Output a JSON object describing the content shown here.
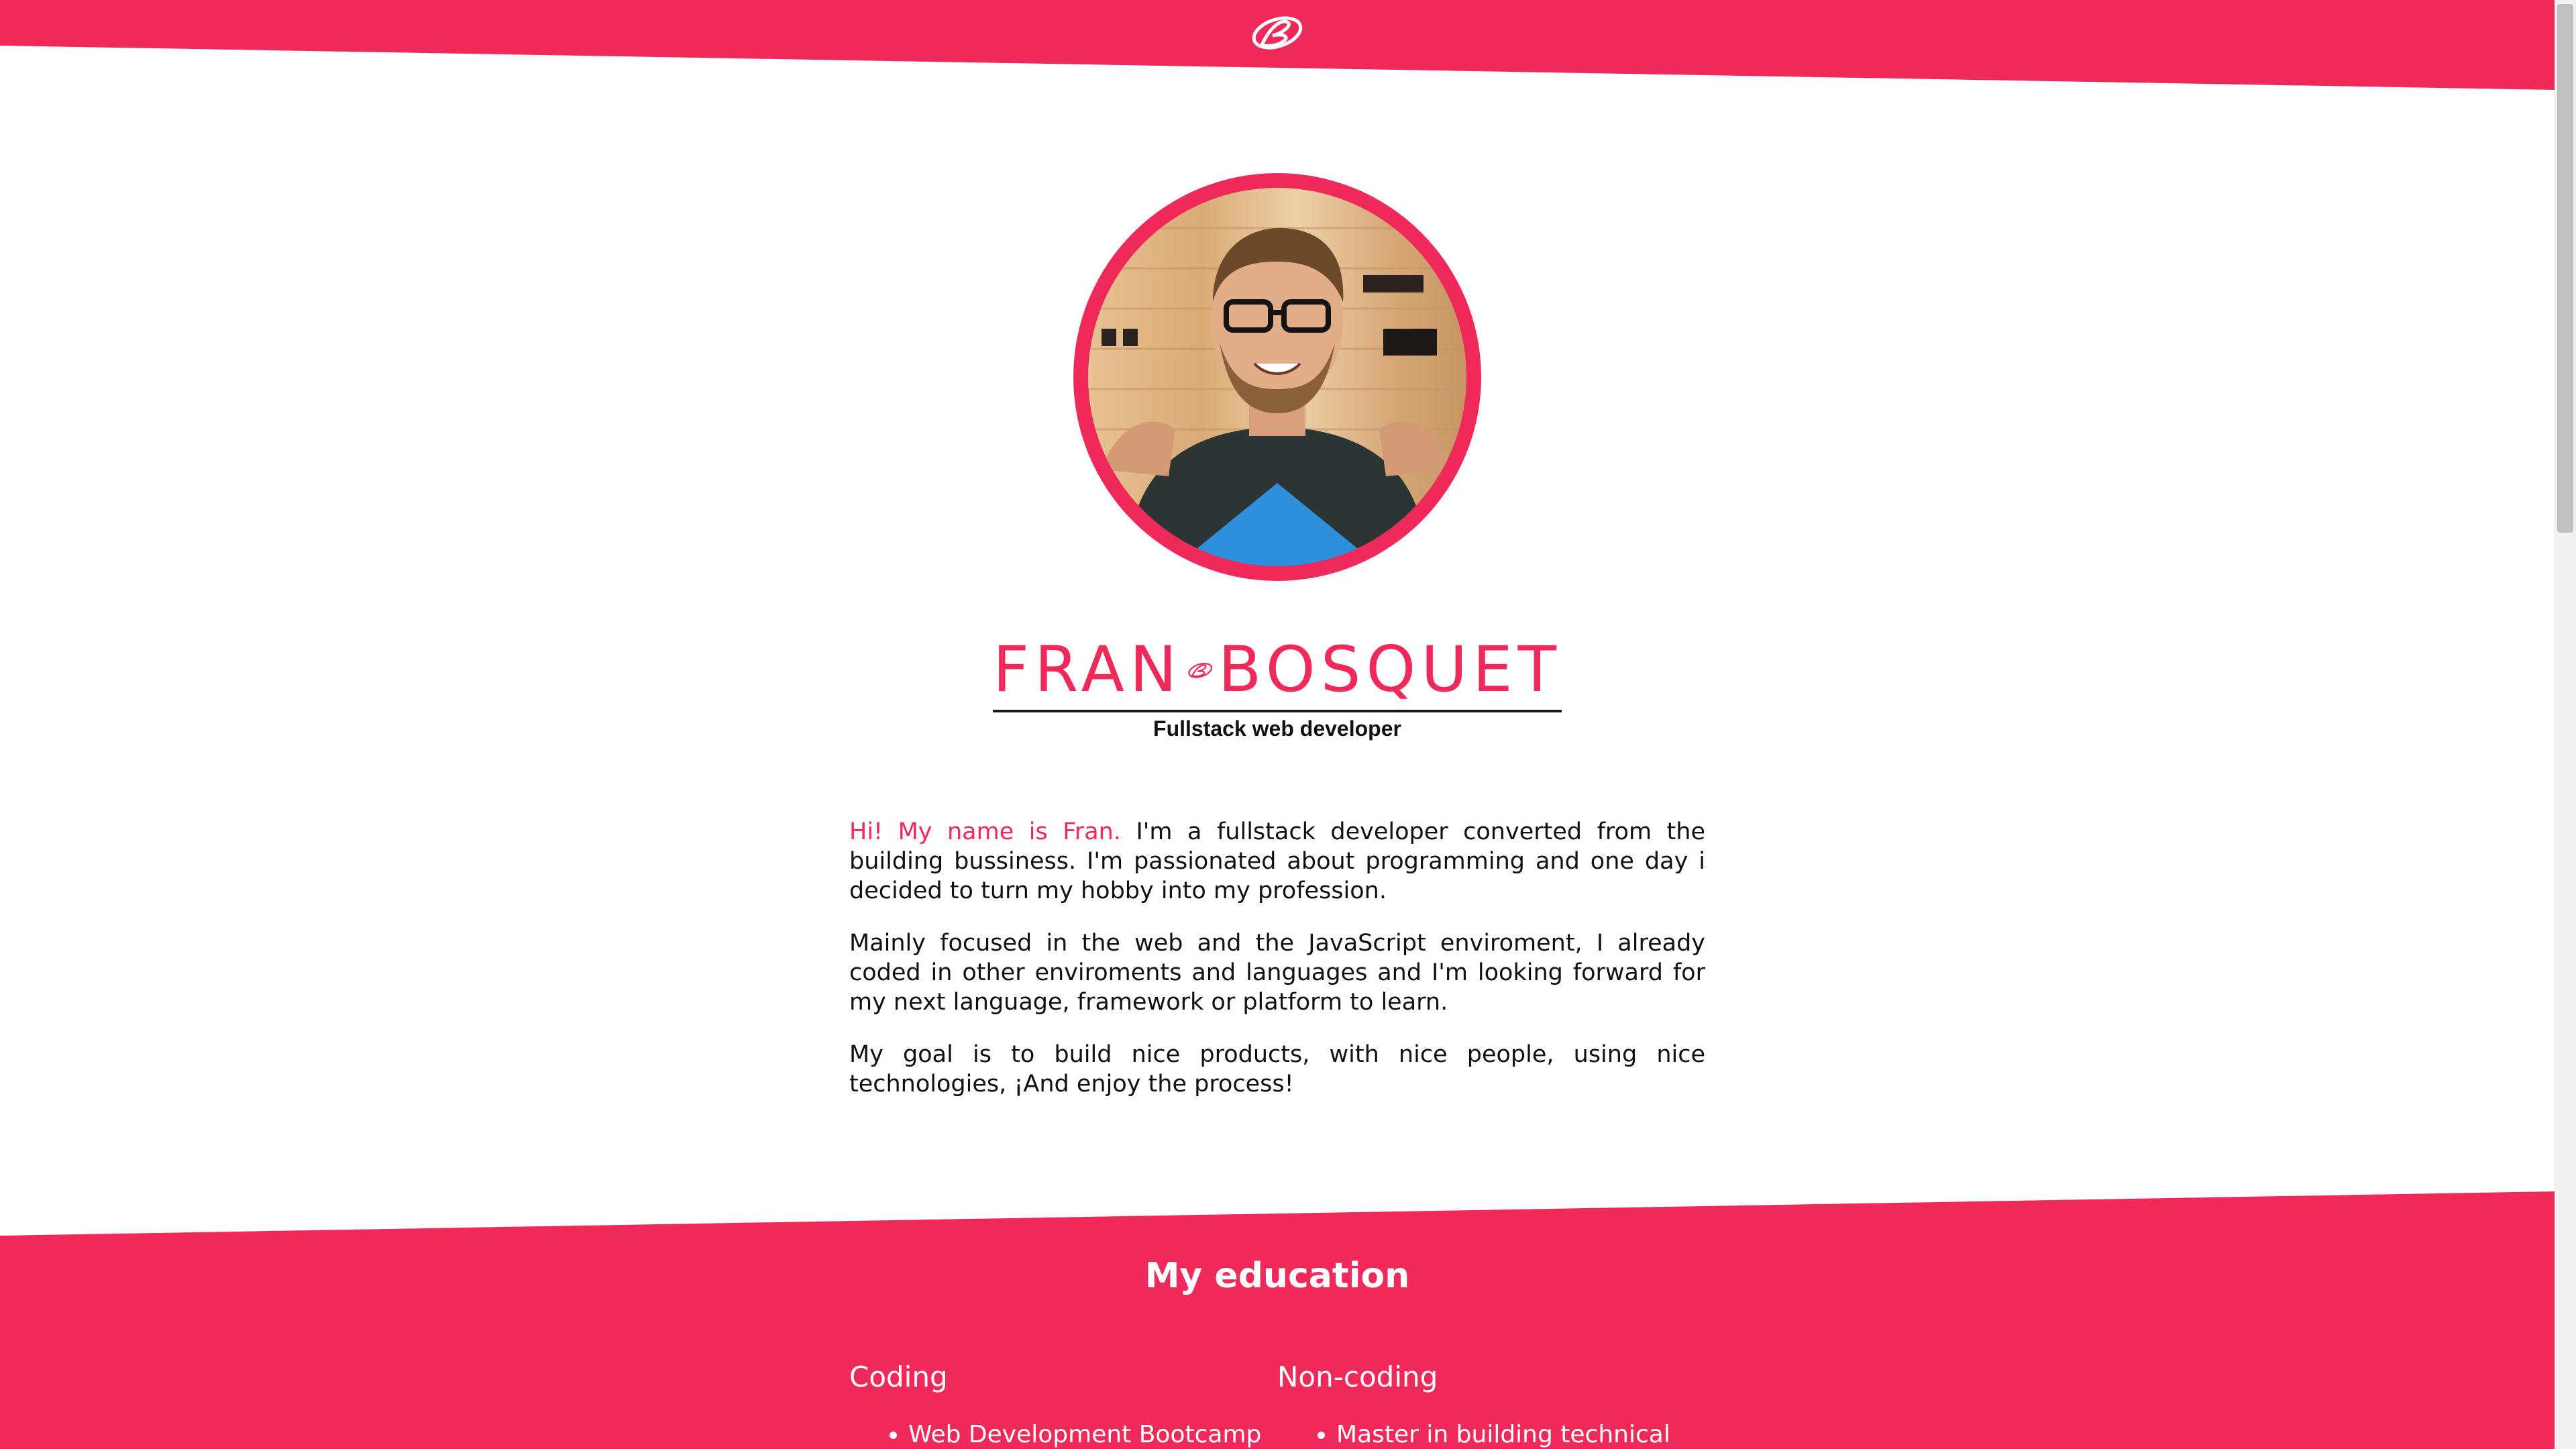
{
  "colors": {
    "accent": "#ef2a5a",
    "background": "#ffffff",
    "text": "#111111"
  },
  "nav": {
    "logo_icon": "fb-monogram-logo"
  },
  "profile": {
    "avatar_alt": "Profile photo",
    "brand_first": "FRAN",
    "brand_last": "BOSQUET",
    "brand_mark_icon": "fb-monogram-logo",
    "tagline": "Fullstack web developer"
  },
  "about": {
    "greeting": "Hi! My name is Fran.",
    "intro": "I'm a fullstack developer converted from the building bussiness. I'm passionated about programming and one day i decided to turn my hobby into my profession.",
    "focus": "Mainly focused in the web and the JavaScript enviroment, I already coded in other enviroments and languages and I'm looking forward for my next language, framework or platform to learn.",
    "goal": "My goal is to build nice products, with nice people, using nice technologies, ¡And enjoy the process!"
  },
  "education": {
    "title": "My education",
    "coding": {
      "heading": "Coding",
      "items": [
        "Web Development Bootcamp"
      ]
    },
    "noncoding": {
      "heading": "Non-coding",
      "items": [
        "Master in building technical"
      ]
    }
  }
}
